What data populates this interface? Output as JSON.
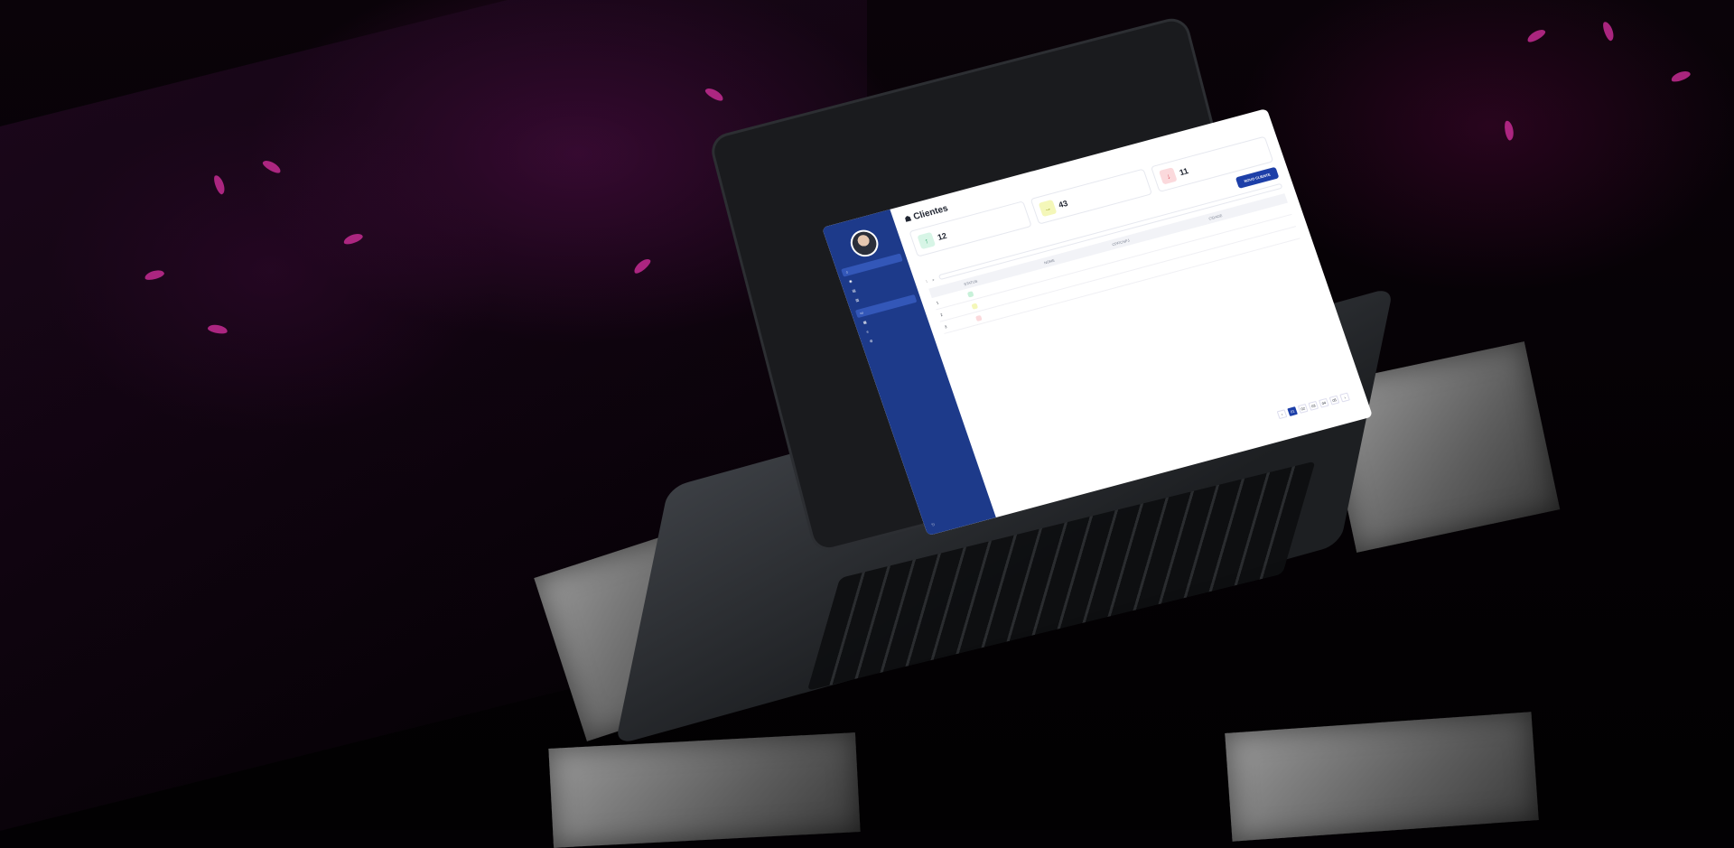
{
  "colors": {
    "accent": "#1d3fa8",
    "sidebar": "#1d3a8a",
    "petal": "#c42c92"
  },
  "page": {
    "title": "Clientes",
    "subtitle": ""
  },
  "sidebar": {
    "user_name": "",
    "user_role": "",
    "section_label": "",
    "items": [
      {
        "label": "",
        "icon": "home-icon"
      },
      {
        "label": "",
        "icon": "users-icon"
      },
      {
        "label": "",
        "icon": "doc-icon"
      },
      {
        "label": "",
        "icon": "chart-icon"
      }
    ],
    "section2_label": "",
    "items2": [
      {
        "label": "",
        "icon": "folder-icon"
      },
      {
        "label": "",
        "icon": "calendar-icon"
      },
      {
        "label": "",
        "icon": "list-icon"
      },
      {
        "label": "",
        "icon": "settings-icon"
      }
    ],
    "logout": ""
  },
  "stats": [
    {
      "value": "12",
      "label": "",
      "icon": "arrow-up-icon",
      "bg": "#d7f5e6",
      "fg": "#2aa56b"
    },
    {
      "value": "43",
      "label": "",
      "icon": "arrow-right-icon",
      "bg": "#f4f7b9",
      "fg": "#9aa020"
    },
    {
      "value": "11",
      "label": "",
      "icon": "arrow-down-icon",
      "bg": "#fbd9dc",
      "fg": "#d8424f"
    }
  ],
  "toolbar": {
    "new_label": "NOVO CLIENTE"
  },
  "filters": {
    "filter_label": "",
    "search_placeholder": ""
  },
  "table": {
    "columns": [
      "STATUS",
      "NOME",
      "CPF/CNPJ",
      "CIDADE"
    ],
    "rows": [
      {
        "id": "1",
        "status": "",
        "status_color": "#c8f1d9",
        "name": "",
        "doc": "",
        "city": ""
      },
      {
        "id": "2",
        "status": "",
        "status_color": "#f4f7b9",
        "name": "",
        "doc": "",
        "city": ""
      },
      {
        "id": "3",
        "status": "",
        "status_color": "#fbd9dc",
        "name": "",
        "doc": "",
        "city": ""
      }
    ]
  },
  "pager": {
    "pages": [
      "01",
      "02",
      "03",
      "04",
      "05"
    ]
  },
  "footer": {
    "rows_label": "",
    "rows_value": "",
    "rows_suffix": ""
  }
}
